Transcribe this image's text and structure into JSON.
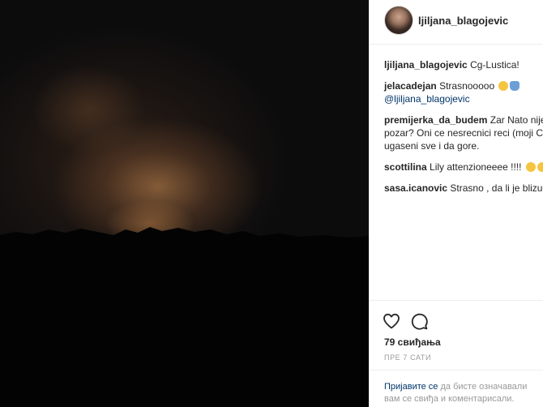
{
  "post": {
    "username": "ljiljana_blagojevic"
  },
  "comments": [
    {
      "user": "ljiljana_blagojevic",
      "text": "Cg-Lustica!"
    },
    {
      "user": "jelacadejan",
      "text": "Strasnooooo",
      "mention": "@ljiljana_blagojevic"
    },
    {
      "user": "premijerka_da_budem",
      "text": "Zar Nato nije u",
      "line2": "pozar? Oni ce nesrecnici reci (moji CG",
      "line3": "ugaseni sve i da gore."
    },
    {
      "user": "scottilina",
      "text": "Lily attenzioneeee !!!!"
    },
    {
      "user": "sasa.icanovic",
      "text": "Strasno , da li je blizu va"
    }
  ],
  "actions": {
    "like_icon": "heart-icon",
    "comment_icon": "comment-icon"
  },
  "likes": "79 свиђања",
  "time_ago": "ПРЕ 7 САТИ",
  "login_prompt": {
    "link": "Пријавите се",
    "text": " да бисте означавали",
    "line2": "вам се свиђа и коментарисали."
  },
  "colors": {
    "link": "#003569",
    "muted": "#999999",
    "text": "#262626",
    "border": "#efefef"
  }
}
